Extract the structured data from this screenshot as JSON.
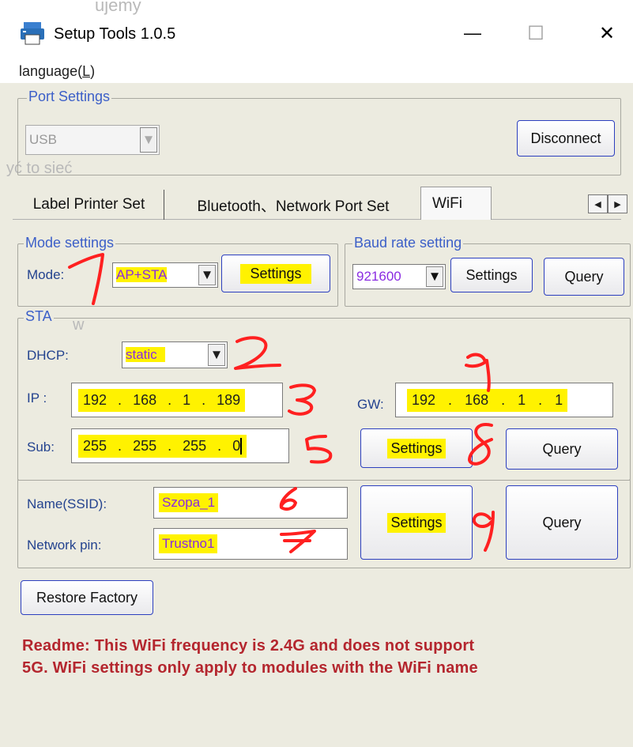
{
  "window": {
    "title": "Setup Tools 1.0.5",
    "app_icon": "printer-icon",
    "minimize_glyph": "—",
    "maximize_glyph": "☐",
    "close_glyph": "✕"
  },
  "background_ghost_text": {
    "line1": "ujemy",
    "line2": "yć to sieć",
    "line3": "w"
  },
  "menu": {
    "language_prefix": "language(",
    "language_key": "L",
    "language_suffix": ")"
  },
  "port_settings": {
    "legend": "Port Settings",
    "port_value": "USB",
    "disconnect_label": "Disconnect"
  },
  "tabs": [
    {
      "label": "Label Printer Set"
    },
    {
      "label": "Bluetooth、Network Port Set"
    },
    {
      "label": "WiFi",
      "active": true
    }
  ],
  "tab_scroll": {
    "left": "◀",
    "right": "▶"
  },
  "mode_settings": {
    "legend": "Mode settings",
    "mode_label": "Mode:",
    "mode_value": "AP+STA",
    "settings_label": "Settings"
  },
  "baud_rate": {
    "legend": "Baud rate setting",
    "value": "921600",
    "settings_label": "Settings",
    "query_label": "Query"
  },
  "sta": {
    "legend": "STA",
    "dhcp_label": "DHCP:",
    "dhcp_value": "static",
    "ip_label": "IP :",
    "ip": [
      "192",
      "168",
      "1",
      "189"
    ],
    "gw_label": "GW:",
    "gw": [
      "192",
      "168",
      "1",
      "1"
    ],
    "sub_label": "Sub:",
    "sub": [
      "255",
      "255",
      "255",
      "0"
    ],
    "settings_label": "Settings",
    "query_label": "Query"
  },
  "wifi": {
    "ssid_label": "Name(SSID):",
    "ssid_value": "Szopa_1",
    "pin_label": "Network pin:",
    "pin_value": "Trustno1",
    "settings_label": "Settings",
    "query_label": "Query"
  },
  "restore_factory_label": "Restore Factory",
  "readme": {
    "line1": "Readme: This WiFi frequency is 2.4G and does not support",
    "line2": "5G. WiFi settings only apply to modules with the WiFi name"
  },
  "annotations": [
    "1",
    "2",
    "3",
    "4",
    "5",
    "6",
    "7",
    "8",
    "9"
  ],
  "colors": {
    "highlight": "#fff200",
    "annotation": "#ff2020",
    "legend_text": "#3c5fc8",
    "readme_text": "#b4262e",
    "button_border": "#2c3fbf"
  }
}
